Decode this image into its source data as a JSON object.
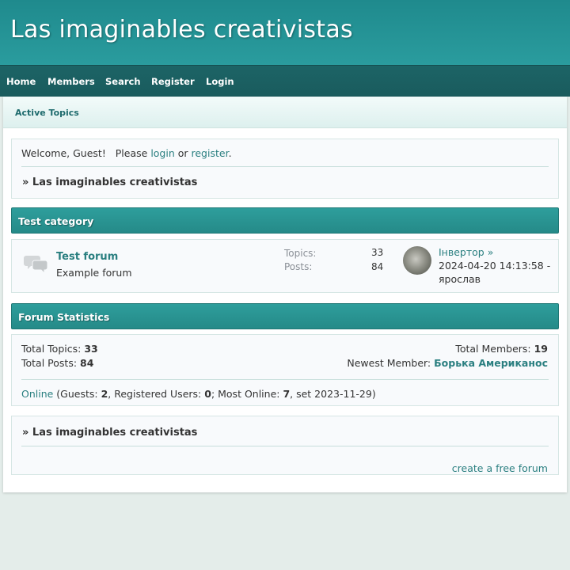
{
  "site": {
    "title": "Las imaginables creativistas"
  },
  "nav": {
    "items": [
      {
        "label": "Home"
      },
      {
        "label": "Members"
      },
      {
        "label": "Search"
      },
      {
        "label": "Register"
      },
      {
        "label": "Login"
      }
    ]
  },
  "subnav": {
    "active_topics": "Active Topics"
  },
  "welcome": {
    "prefix": "Welcome, Guest!   Please ",
    "login": "login",
    "or": " or ",
    "register": "register",
    "suffix": ".",
    "breadcrumb": "» Las imaginables creativistas"
  },
  "category": {
    "title": "Test category",
    "forum": {
      "name": "Test forum",
      "description": "Example forum",
      "topics_label": "Topics:",
      "topics_value": "33",
      "posts_label": "Posts:",
      "posts_value": "84",
      "last_post_user": "Інвертор »",
      "last_post_date": "2024-04-20 14:13:58 -",
      "last_post_by": "ярослав"
    }
  },
  "statistics": {
    "title": "Forum Statistics",
    "total_topics_label": "Total Topics: ",
    "total_topics": "33",
    "total_posts_label": "Total Posts: ",
    "total_posts": "84",
    "total_members_label": "Total Members: ",
    "total_members": "19",
    "newest_member_label": "Newest Member: ",
    "newest_member": "Борька Американос",
    "online_link": "Online",
    "guests_label": " (Guests: ",
    "guests": "2",
    "registered_label": ", Registered Users: ",
    "registered": "0",
    "most_online_label": "; Most Online: ",
    "most_online": "7",
    "most_online_date": ", set 2023-11-29)"
  },
  "footer": {
    "breadcrumb": "» Las imaginables creativistas",
    "free_forum": "create a free forum"
  }
}
